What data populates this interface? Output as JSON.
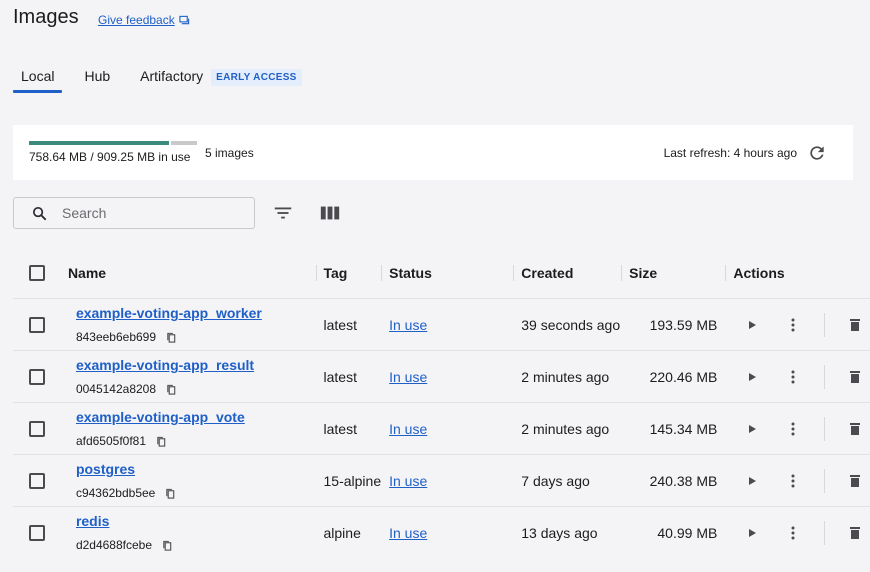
{
  "header": {
    "title": "Images",
    "feedback_label": "Give feedback"
  },
  "tabs": [
    {
      "label": "Local",
      "active": true
    },
    {
      "label": "Hub",
      "active": false
    },
    {
      "label": "Artifactory",
      "active": false,
      "badge": "EARLY ACCESS"
    }
  ],
  "usage": {
    "used_fraction": 0.834,
    "text": "758.64 MB / 909.25 MB in use",
    "count": "5 images",
    "last_refresh": "Last refresh: 4 hours ago"
  },
  "search": {
    "placeholder": "Search",
    "value": ""
  },
  "table": {
    "columns": [
      "Name",
      "Tag",
      "Status",
      "Created",
      "Size",
      "Actions"
    ],
    "rows": [
      {
        "name": "example-voting-app_worker",
        "id": "843eeb6eb699",
        "tag": "latest",
        "status": "In use",
        "created": "39 seconds ago",
        "size": "193.59 MB"
      },
      {
        "name": "example-voting-app_result",
        "id": "0045142a8208",
        "tag": "latest",
        "status": "In use",
        "created": "2 minutes ago",
        "size": "220.46 MB"
      },
      {
        "name": "example-voting-app_vote",
        "id": "afd6505f0f81",
        "tag": "latest",
        "status": "In use",
        "created": "2 minutes ago",
        "size": "145.34 MB"
      },
      {
        "name": "postgres",
        "id": "c94362bdb5ee",
        "tag": "15-alpine",
        "status": "In use",
        "created": "7 days ago",
        "size": "240.38 MB"
      },
      {
        "name": "redis",
        "id": "d2d4688fcebe",
        "tag": "alpine",
        "status": "In use",
        "created": "13 days ago",
        "size": "40.99 MB"
      }
    ]
  },
  "colors": {
    "accent": "#1f5fc8",
    "usage_fill": "#3a8b7e",
    "usage_rest": "#c9c9cc"
  },
  "icons": [
    "feedback-icon",
    "refresh-icon",
    "search-icon",
    "filter-icon",
    "columns-icon",
    "copy-icon",
    "play-icon",
    "more-vertical-icon",
    "trash-icon"
  ]
}
